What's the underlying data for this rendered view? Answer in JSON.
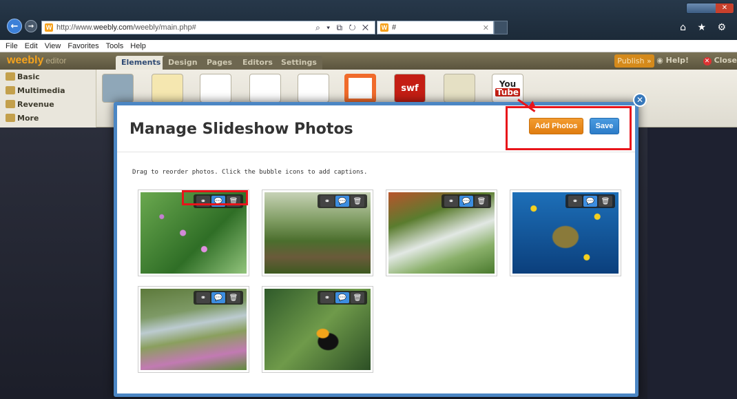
{
  "browser": {
    "url_prefix": "http://www.",
    "url_host": "weebly.com",
    "url_path": "/weebly/main.php#",
    "tab_title": "#",
    "address_tools": "⌕ ▾ ⧉ ↻ ✕",
    "chrome_icons": "⌂ ★ ⚙"
  },
  "menu": [
    "File",
    "Edit",
    "View",
    "Favorites",
    "Tools",
    "Help"
  ],
  "editor": {
    "logo": "weebly",
    "logo_sub": "editor",
    "tabs": [
      "Elements",
      "Design",
      "Pages",
      "Editors",
      "Settings"
    ],
    "publish": "Publish »",
    "help": "Help!",
    "close": "Close"
  },
  "categories": [
    "Basic",
    "Multimedia",
    "Revenue",
    "More"
  ],
  "elements": {
    "swf": "swf",
    "you_top": "You",
    "you_bottom": "Tube"
  },
  "modal": {
    "title": "Manage Slideshow Photos",
    "add_photos": "Add Photos",
    "save": "Save",
    "instructions": "Drag to reorder photos. Click the bubble icons to add captions.",
    "close_glyph": "✕"
  },
  "photo_tools": {
    "link": "⚭",
    "caption": "💬",
    "delete": "🗑"
  },
  "photos": [
    {
      "subject": "pink flowers"
    },
    {
      "subject": "forest path"
    },
    {
      "subject": "waterfall"
    },
    {
      "subject": "sea turtle"
    },
    {
      "subject": "stream meadow"
    },
    {
      "subject": "toucan"
    }
  ]
}
